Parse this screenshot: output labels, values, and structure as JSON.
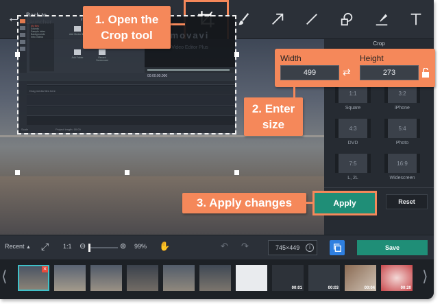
{
  "toolbar": {
    "back_label": "Back to\nLauncher"
  },
  "inner": {
    "import_title": "Import",
    "list": [
      "My files",
      "Sounds",
      "Sample video",
      "Backgrounds",
      "Intro videos"
    ],
    "buttons": [
      "Add Media files",
      "Record video",
      "Add Folder",
      "Record Screencast"
    ],
    "logo": "movavi",
    "product": "Video Editor Plus",
    "timecode": "00:00:00.000",
    "hint": "Drag media files here",
    "scale": "Scale",
    "length": "Project length: 00:00"
  },
  "crop": {
    "panel_title": "Crop",
    "width_label": "Width",
    "height_label": "Height",
    "width_value": "499",
    "height_value": "273",
    "ratios": [
      {
        "value": "1:1",
        "label": "Square"
      },
      {
        "value": "3:2",
        "label": "iPhone"
      },
      {
        "value": "4:3",
        "label": "DVD"
      },
      {
        "value": "5:4",
        "label": "Photo"
      },
      {
        "value": "7:5",
        "label": "L, 2L"
      },
      {
        "value": "16:9",
        "label": "Widescreen"
      }
    ],
    "apply_label": "Apply",
    "reset_label": "Reset"
  },
  "bottom": {
    "recent_label": "Recent",
    "actual_size": "1:1",
    "zoom": "99%",
    "dimensions": "745×449",
    "save_label": "Save"
  },
  "filmstrip": {
    "durations": [
      "00:01",
      "00:03",
      "00:04",
      "00:20"
    ]
  },
  "callouts": {
    "step1": "1. Open the\nCrop tool",
    "step2": "2. Enter\nsize",
    "step3": "3. Apply changes"
  },
  "colors": {
    "accent_orange": "#f5885a",
    "apply_green": "#1f8e77",
    "copy_blue": "#2e7fe0",
    "selected_thumb": "#3fc1c9"
  }
}
